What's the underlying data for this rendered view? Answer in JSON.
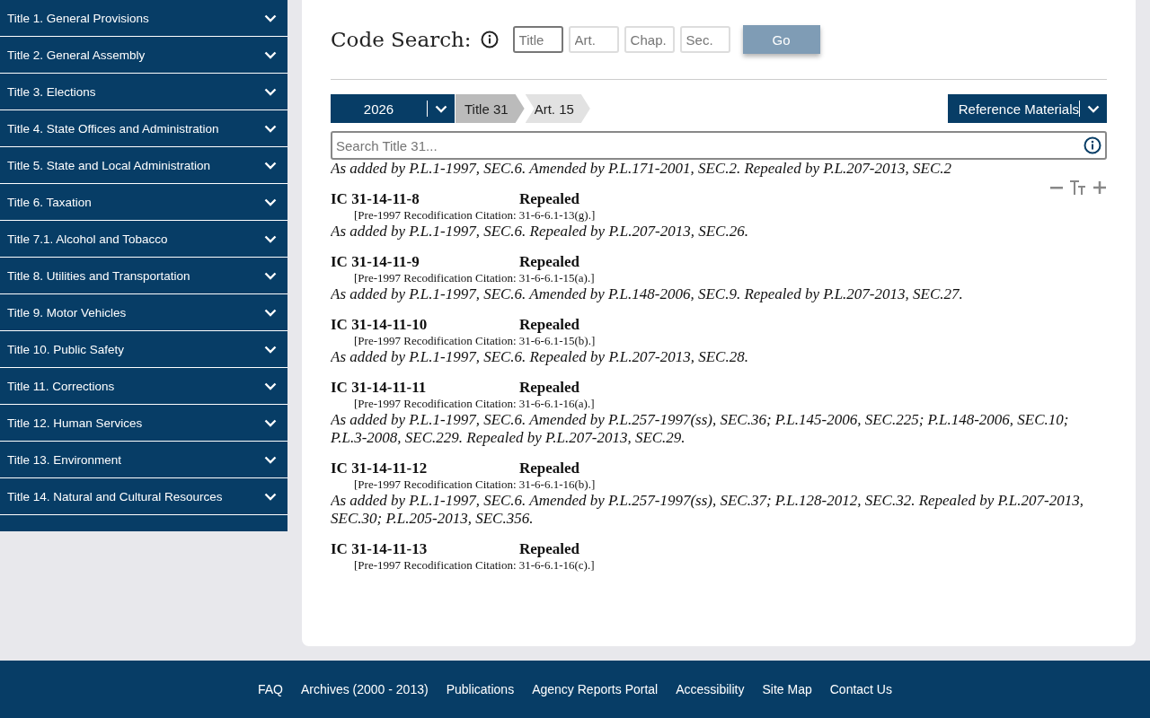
{
  "sidebar": {
    "items": [
      {
        "label": "Title 1. General Provisions"
      },
      {
        "label": "Title 2. General Assembly"
      },
      {
        "label": "Title 3. Elections"
      },
      {
        "label": "Title 4. State Offices and Administration"
      },
      {
        "label": "Title 5. State and Local Administration"
      },
      {
        "label": "Title 6. Taxation"
      },
      {
        "label": "Title 7.1. Alcohol and Tobacco"
      },
      {
        "label": "Title 8. Utilities and Transportation"
      },
      {
        "label": "Title 9. Motor Vehicles"
      },
      {
        "label": "Title 10. Public Safety"
      },
      {
        "label": "Title 11. Corrections"
      },
      {
        "label": "Title 12. Human Services"
      },
      {
        "label": "Title 13. Environment"
      },
      {
        "label": "Title 14. Natural and Cultural Resources"
      }
    ]
  },
  "code_search": {
    "label": "Code Search:",
    "fields": [
      {
        "placeholder": "Title"
      },
      {
        "placeholder": "Art."
      },
      {
        "placeholder": "Chap."
      },
      {
        "placeholder": "Sec."
      }
    ],
    "button": "Go"
  },
  "breadcrumb": {
    "year": "2026",
    "crumbs": [
      {
        "label": "Title 31",
        "selected": true
      },
      {
        "label": "Art. 15",
        "selected": false
      }
    ],
    "reference": "Reference Materials"
  },
  "search": {
    "placeholder": "Search Title 31..."
  },
  "content": {
    "top_line": "As added by P.L.1-1997, SEC.6. Amended by P.L.171-2001, SEC.2. Repealed by P.L.207-2013, SEC.2",
    "sections": [
      {
        "id": "IC 31-14-11-8",
        "status": "Repealed",
        "citation": "[Pre-1997 Recodification Citation: 31-6-6.1-13(g).]",
        "history": "As added by P.L.1-1997, SEC.6. Repealed by P.L.207-2013, SEC.26."
      },
      {
        "id": "IC 31-14-11-9",
        "status": "Repealed",
        "citation": "[Pre-1997 Recodification Citation: 31-6-6.1-15(a).]",
        "history": "As added by P.L.1-1997, SEC.6. Amended by P.L.148-2006, SEC.9. Repealed by P.L.207-2013, SEC.27."
      },
      {
        "id": "IC 31-14-11-10",
        "status": "Repealed",
        "citation": "[Pre-1997 Recodification Citation: 31-6-6.1-15(b).]",
        "history": "As added by P.L.1-1997, SEC.6. Repealed by P.L.207-2013, SEC.28."
      },
      {
        "id": "IC 31-14-11-11",
        "status": "Repealed",
        "citation": "[Pre-1997 Recodification Citation: 31-6-6.1-16(a).]",
        "history": "As added by P.L.1-1997, SEC.6. Amended by P.L.257-1997(ss), SEC.36; P.L.145-2006, SEC.225; P.L.148-2006, SEC.10; P.L.3-2008, SEC.229. Repealed by P.L.207-2013, SEC.29."
      },
      {
        "id": "IC 31-14-11-12",
        "status": "Repealed",
        "citation": "[Pre-1997 Recodification Citation: 31-6-6.1-16(b).]",
        "history": "As added by P.L.1-1997, SEC.6. Amended by P.L.257-1997(ss), SEC.37; P.L.128-2012, SEC.32. Repealed by P.L.207-2013, SEC.30; P.L.205-2013, SEC.356."
      },
      {
        "id": "IC 31-14-11-13",
        "status": "Repealed",
        "citation": "[Pre-1997 Recodification Citation: 31-6-6.1-16(c).]"
      }
    ]
  },
  "footer": {
    "links": [
      "FAQ",
      "Archives (2000 - 2013)",
      "Publications",
      "Agency Reports Portal",
      "Accessibility",
      "Site Map",
      "Contact Us"
    ]
  }
}
